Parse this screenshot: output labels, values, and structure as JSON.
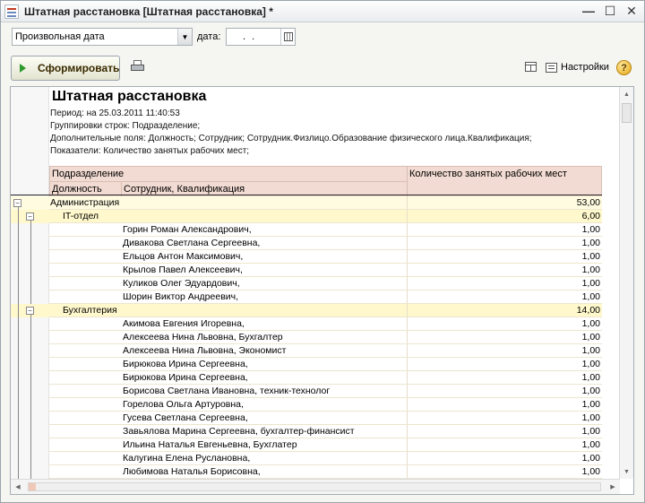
{
  "window": {
    "title": "Штатная расстановка [Штатная расстановка] *"
  },
  "controls": {
    "period_value": "Произвольная дата",
    "date_label": "дата:",
    "date_value": ". .",
    "form_button": "Сформировать",
    "settings_label": "Настройки",
    "help_glyph": "?"
  },
  "report": {
    "title": "Штатная расстановка",
    "period": "Период: на 25.03.2011 11:40:53",
    "grouping": "Группировки строк: Подразделение;",
    "extra_fields": "Дополнительные поля: Должность; Сотрудник; Сотрудник.Физлицо.Образование физического лица.Квалификация;",
    "indicators": "Показатели: Количество занятых рабочих мест;",
    "headers": {
      "division": "Подразделение",
      "count": "Количество занятых рабочих мест",
      "position": "Должность",
      "employee": "Сотрудник, Квалификация"
    },
    "rows": [
      {
        "name": "Администрация",
        "value": "53,00"
      },
      {
        "name": "IT-отдел",
        "value": "6,00"
      },
      {
        "name": "Горин Роман Александрович,",
        "value": "1,00"
      },
      {
        "name": "Дивакова Светлана Сергеевна,",
        "value": "1,00"
      },
      {
        "name": "Ельцов Антон Максимович,",
        "value": "1,00"
      },
      {
        "name": "Крылов Павел Алексеевич,",
        "value": "1,00"
      },
      {
        "name": "Куликов Олег Эдуардович,",
        "value": "1,00"
      },
      {
        "name": "Шорин Виктор Андреевич,",
        "value": "1,00"
      },
      {
        "name": "Бухгалтерия",
        "value": "14,00"
      },
      {
        "name": "Акимова Евгения Игоревна,",
        "value": "1,00"
      },
      {
        "name": "Алексеева Нина Львовна, Бухгалтер",
        "value": "1,00"
      },
      {
        "name": "Алексеева Нина Львовна, Экономист",
        "value": "1,00"
      },
      {
        "name": "Бирюкова Ирина Сергеевна,",
        "value": "1,00"
      },
      {
        "name": "Бирюкова Ирина Сергеевна,",
        "value": "1,00"
      },
      {
        "name": "Борисова Светлана Ивановна, техник-технолог",
        "value": "1,00"
      },
      {
        "name": "Горелова Ольга Артуровна,",
        "value": "1,00"
      },
      {
        "name": "Гусева Светлана Сергеевна,",
        "value": "1,00"
      },
      {
        "name": "Завьялова Марина Сергеевна, бухгалтер-финансист",
        "value": "1,00"
      },
      {
        "name": "Ильина Наталья Евгеньевна, Бухглатер",
        "value": "1,00"
      },
      {
        "name": "Калугина Елена Руслановна,",
        "value": "1,00"
      },
      {
        "name": "Любимова Наталья Борисовна,",
        "value": "1,00"
      }
    ]
  },
  "icons": [
    "report-app-icon",
    "minimize-icon",
    "maximize-icon",
    "close-icon",
    "dropdown-arrow-icon",
    "calendar-icon",
    "play-icon",
    "print-icon",
    "layout-icon",
    "settings-icon",
    "help-icon",
    "tree-collapse-icon"
  ]
}
